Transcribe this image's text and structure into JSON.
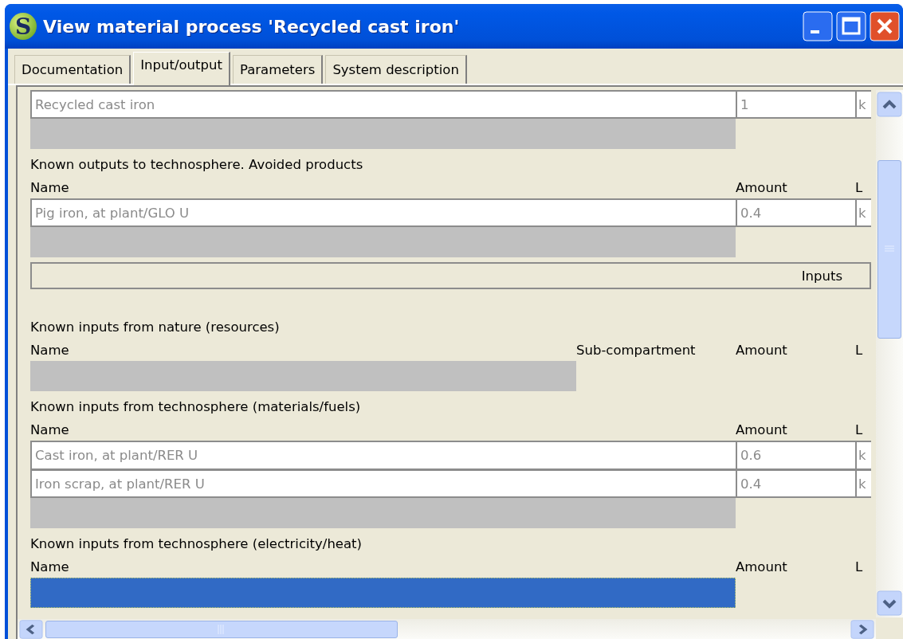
{
  "window": {
    "icon_text": "S",
    "title": "View material process 'Recycled cast iron'"
  },
  "tabs": [
    {
      "label": "Documentation",
      "selected": false
    },
    {
      "label": "Input/output",
      "selected": true
    },
    {
      "label": "Parameters",
      "selected": false
    },
    {
      "label": "System description",
      "selected": false
    }
  ],
  "blocks": [
    {
      "kind": "table",
      "rows": [
        {
          "name": "Recycled cast iron",
          "amount": "1",
          "unit": "k"
        }
      ],
      "new_row": {
        "selected": false
      }
    },
    {
      "kind": "table",
      "title": "Known outputs to technosphere. Avoided products",
      "columns": [
        "Name",
        "Amount",
        "L"
      ],
      "rows": [
        {
          "name": "Pig iron, at plant/GLO U",
          "amount": "0.4",
          "unit": "k"
        }
      ],
      "new_row": {
        "selected": false
      }
    },
    {
      "kind": "divider",
      "label": "Inputs"
    },
    {
      "kind": "table",
      "title": "Known inputs from nature (resources)",
      "columns": [
        "Name",
        "Sub-compartment",
        "Amount",
        "L"
      ],
      "new_row": {
        "selected": false
      }
    },
    {
      "kind": "table",
      "title": "Known inputs from technosphere (materials/fuels)",
      "columns": [
        "Name",
        "Amount",
        "L"
      ],
      "rows": [
        {
          "name": "Cast iron, at plant/RER U",
          "amount": "0.6",
          "unit": "k"
        },
        {
          "name": "Iron scrap, at plant/RER U",
          "amount": "0.4",
          "unit": "k"
        }
      ],
      "new_row": {
        "selected": false
      }
    },
    {
      "kind": "table",
      "title": "Known inputs from technosphere (electricity/heat)",
      "columns": [
        "Name",
        "Amount",
        "L"
      ],
      "new_row": {
        "selected": true
      }
    }
  ]
}
